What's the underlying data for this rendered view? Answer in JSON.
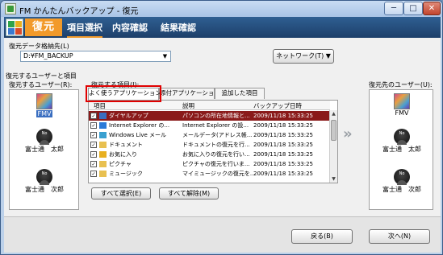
{
  "window": {
    "title": "FM かんたんバックアップ - 復元",
    "min_label": "─",
    "max_label": "□",
    "close_label": "✕"
  },
  "header": {
    "mode_title": "復元",
    "steps": [
      "項目選択",
      "内容確認",
      "結果確認"
    ]
  },
  "restore_source": {
    "label": "復元データ格納先(L)",
    "value": "D:¥FM_BACKUP",
    "network_button": "ネットワーク(T) ▼"
  },
  "section_label": "復元するユーザーと項目",
  "source_users": {
    "label": "復元するユーザー(R):",
    "users": [
      {
        "name": "FMV",
        "avatar": "fmv-avatar"
      },
      {
        "name": "富士通　太郎",
        "avatar": "no-image-avatar"
      },
      {
        "name": "富士通　次郎",
        "avatar": "no-image-avatar"
      }
    ]
  },
  "items": {
    "label": "復元する項目(I):",
    "tabs": [
      "よく使うアプリケーション",
      "添付アプリケーション",
      "追加した項目"
    ],
    "columns": [
      "項目",
      "説明",
      "バックアップ日時"
    ],
    "rows": [
      {
        "checked": true,
        "name": "ダイヤルアップ",
        "desc": "パソコンの所在地情報と...",
        "date": "2009/11/18  15:33:25",
        "icon": "dialup-icon",
        "selected": true
      },
      {
        "checked": true,
        "name": "Internet Explorer の...",
        "desc": "Internet Explorer の設...",
        "date": "2009/11/18  15:33:25",
        "icon": "ie-icon",
        "selected": false
      },
      {
        "checked": true,
        "name": "Windows Live メール",
        "desc": "メールデータ(アドレス帳...",
        "date": "2009/11/18  15:33:25",
        "icon": "mail-icon",
        "selected": false
      },
      {
        "checked": true,
        "name": "ドキュメント",
        "desc": "ドキュメントの復元を行...",
        "date": "2009/11/18  15:33:25",
        "icon": "folder-icon",
        "selected": false
      },
      {
        "checked": true,
        "name": "お気に入り",
        "desc": "お気に入りの復元を行い...",
        "date": "2009/11/18  15:33:25",
        "icon": "favorites-icon",
        "selected": false
      },
      {
        "checked": true,
        "name": "ピクチャ",
        "desc": "ピクチャの復元を行いま...",
        "date": "2009/11/18  15:33:25",
        "icon": "folder-icon",
        "selected": false
      },
      {
        "checked": true,
        "name": "ミュージック",
        "desc": "マイミュージックの復元を...",
        "date": "2009/11/18  15:33:25",
        "icon": "folder-icon",
        "selected": false
      }
    ],
    "select_all": "すべて選択(E)",
    "deselect_all": "すべて解除(M)"
  },
  "target_users": {
    "label": "復元先のユーザー(U):",
    "users": [
      {
        "name": "FMV",
        "avatar": "fmv-avatar"
      },
      {
        "name": "富士通　太郎",
        "avatar": "no-image-avatar"
      },
      {
        "name": "富士通　次郎",
        "avatar": "no-image-avatar"
      }
    ]
  },
  "arrow_glyph": "»",
  "footer": {
    "back": "戻る(B)",
    "next": "次へ(N)"
  },
  "colors": {
    "header_bg": "#1d3f6a",
    "mode_accent": "#f29a2a",
    "selected_row": "#8a1a1a",
    "highlight_box": "#e00000"
  }
}
